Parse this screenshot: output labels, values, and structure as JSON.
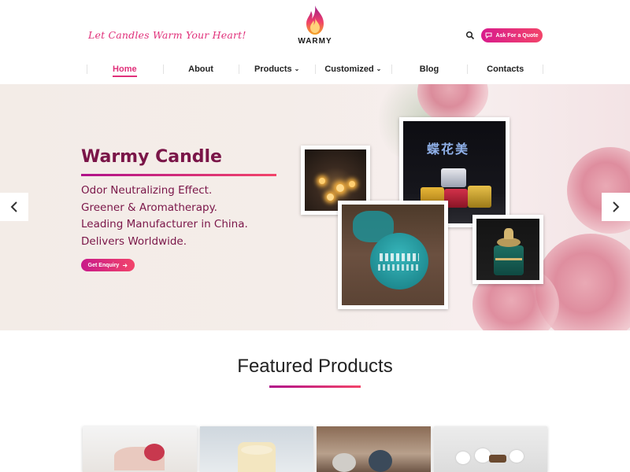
{
  "header": {
    "tagline": "Let Candles Warm Your Heart!",
    "logo_text": "WARMY",
    "quote_button": "Ask For a Quote"
  },
  "nav": {
    "items": [
      {
        "label": "Home",
        "active": true,
        "dropdown": false
      },
      {
        "label": "About",
        "active": false,
        "dropdown": false
      },
      {
        "label": "Products",
        "active": false,
        "dropdown": true
      },
      {
        "label": "Customized",
        "active": false,
        "dropdown": true
      },
      {
        "label": "Blog",
        "active": false,
        "dropdown": false
      },
      {
        "label": "Contacts",
        "active": false,
        "dropdown": false
      }
    ]
  },
  "hero": {
    "title": "Warmy Candle",
    "lines": [
      "Odor Neutralizing Effect.",
      "Greener & Aromatherapy.",
      "Leading Manufacturer in China.",
      "Delivers Worldwide."
    ],
    "button": "Get Enquiry",
    "photo_caption": "蝶花美"
  },
  "featured": {
    "title": "Featured Products"
  },
  "colors": {
    "accent": "#e0307a",
    "accent_dark": "#7a1548",
    "gradient_start": "#b0128a",
    "gradient_end": "#f2446a"
  },
  "icons": [
    "flame-logo-icon",
    "search-icon",
    "chat-icon",
    "arrow-right-icon",
    "chevron-left-icon",
    "chevron-right-icon",
    "chevron-down-icon"
  ]
}
